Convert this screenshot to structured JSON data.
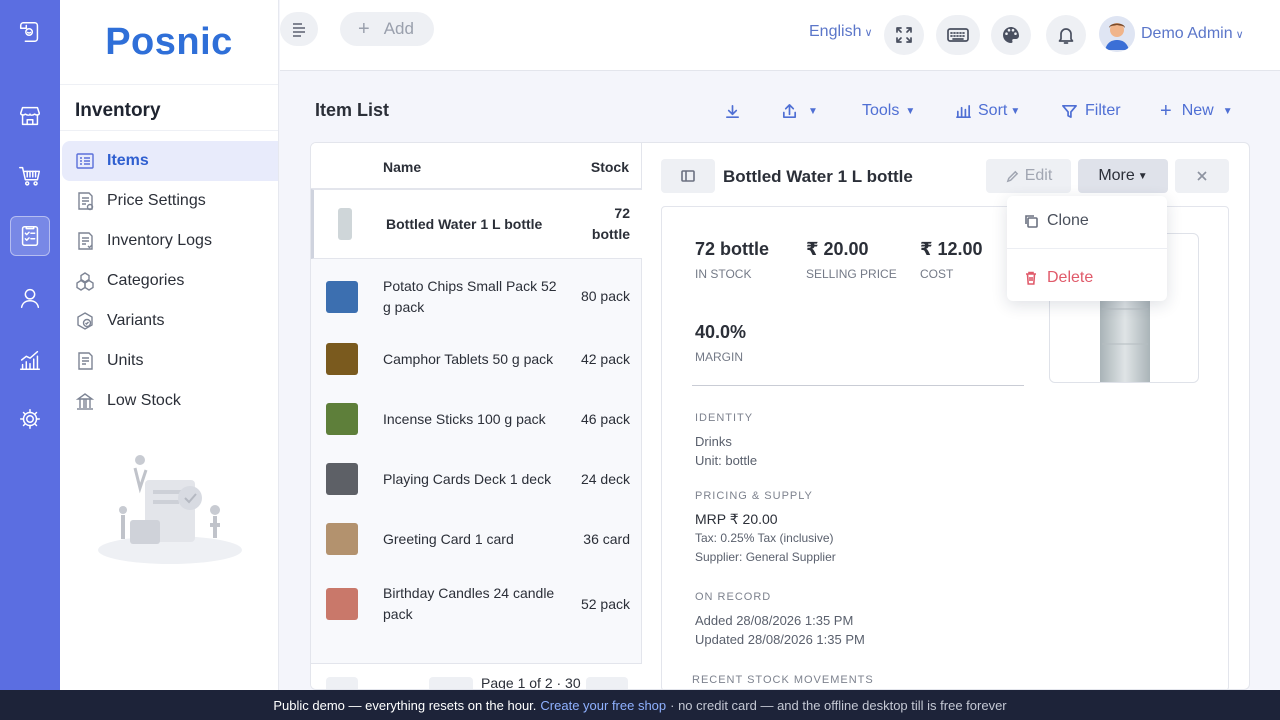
{
  "brand": {
    "name": "Posnic"
  },
  "topbar": {
    "add_label": "Add",
    "language": "English",
    "user_name": "Demo Admin"
  },
  "sidebar": {
    "title": "Inventory",
    "items": [
      {
        "label": "Items",
        "icon": "items-icon",
        "active": true
      },
      {
        "label": "Price Settings",
        "icon": "price-settings-icon"
      },
      {
        "label": "Inventory Logs",
        "icon": "inventory-logs-icon"
      },
      {
        "label": "Categories",
        "icon": "categories-icon"
      },
      {
        "label": "Variants",
        "icon": "variants-icon"
      },
      {
        "label": "Units",
        "icon": "units-icon"
      },
      {
        "label": "Low Stock",
        "icon": "low-stock-icon"
      }
    ]
  },
  "page": {
    "title": "Item List",
    "toolbar": {
      "tools": "Tools",
      "sort": "Sort",
      "filter": "Filter",
      "new": "New"
    }
  },
  "list": {
    "columns": {
      "name": "Name",
      "stock": "Stock"
    },
    "rows": [
      {
        "name": "Bottled Water 1 L bottle",
        "stock": "72 bottle",
        "thumb": "#b9c4c8"
      },
      {
        "name": "Potato Chips Small Pack 52 g pack",
        "stock": "80 pack",
        "thumb": "#3c6fb0"
      },
      {
        "name": "Camphor Tablets 50 g pack",
        "stock": "42 pack",
        "thumb": "#7a5a1e"
      },
      {
        "name": "Incense Sticks 100 g pack",
        "stock": "46 pack",
        "thumb": "#5e7f3a"
      },
      {
        "name": "Playing Cards Deck 1 deck",
        "stock": "24 deck",
        "thumb": "#5d6066"
      },
      {
        "name": "Greeting Card 1 card",
        "stock": "36 card",
        "thumb": "#b3926e"
      },
      {
        "name": "Birthday Candles 24 candle pack",
        "stock": "52 pack",
        "thumb": "#c9786a"
      }
    ],
    "pagination": "Page 1 of 2 · 30",
    "page_labels": [
      "1",
      "2"
    ]
  },
  "detail": {
    "title": "Bottled Water 1 L bottle",
    "edit_label": "Edit",
    "more_label": "More",
    "metrics": [
      {
        "value": "72 bottle",
        "label": "IN STOCK"
      },
      {
        "value": "₹ 20.00",
        "label": "SELLING PRICE"
      },
      {
        "value": "₹ 12.00",
        "label": "COST"
      },
      {
        "value": "40.0%",
        "label": "MARGIN"
      }
    ],
    "identity": {
      "heading": "IDENTITY",
      "category": "Drinks",
      "unit": "Unit: bottle"
    },
    "pricing": {
      "heading": "PRICING & SUPPLY",
      "mrp": "MRP ₹ 20.00",
      "tax": "Tax: 0.25% Tax (inclusive)",
      "supplier": "Supplier: General Supplier"
    },
    "record": {
      "heading": "ON RECORD",
      "added": "Added 28/08/2026 1:35 PM",
      "updated": "Updated 28/08/2026 1:35 PM"
    },
    "movements_heading": "RECENT STOCK MOVEMENTS"
  },
  "more_menu": {
    "clone": "Clone",
    "delete": "Delete"
  },
  "banner": {
    "text": "Public demo — everything resets on the hour.",
    "link": "Create your free shop",
    "tail": "· no credit card — and the offline desktop till is free forever"
  },
  "colors": {
    "rail": "#5b6ee1",
    "brand": "#2f6fd8",
    "accent": "#4f6fd4",
    "danger": "#e05a6a",
    "banner": "#1d2339"
  }
}
